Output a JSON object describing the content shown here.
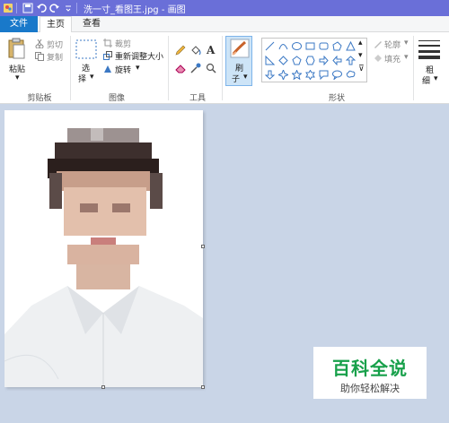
{
  "window": {
    "title": "洗一寸_看图王.jpg - 画图"
  },
  "tabs": {
    "file": "文件",
    "home": "主页",
    "view": "查看"
  },
  "ribbon": {
    "clipboard": {
      "paste": "粘贴",
      "cut": "剪切",
      "copy": "复制",
      "group": "剪贴板"
    },
    "image": {
      "select_line1": "选",
      "select_line2": "择",
      "crop": "裁剪",
      "resize": "重新调整大小",
      "rotate": "旋转",
      "group": "图像"
    },
    "tools": {
      "group": "工具"
    },
    "brushes": {
      "line1": "刷",
      "line2": "子"
    },
    "shapes": {
      "outline": "轮廓",
      "fill": "填充",
      "group": "形状"
    },
    "size": {
      "line1": "粗",
      "line2": "细"
    }
  },
  "watermark": {
    "title": "百科全说",
    "subtitle": "助你轻松解决"
  },
  "colors": {
    "titlebar": "#6a6fd8",
    "file_tab": "#1979ca",
    "workspace": "#c9d5e7",
    "brush_highlight": "#cde4f7",
    "watermark_green": "#17a04a"
  }
}
